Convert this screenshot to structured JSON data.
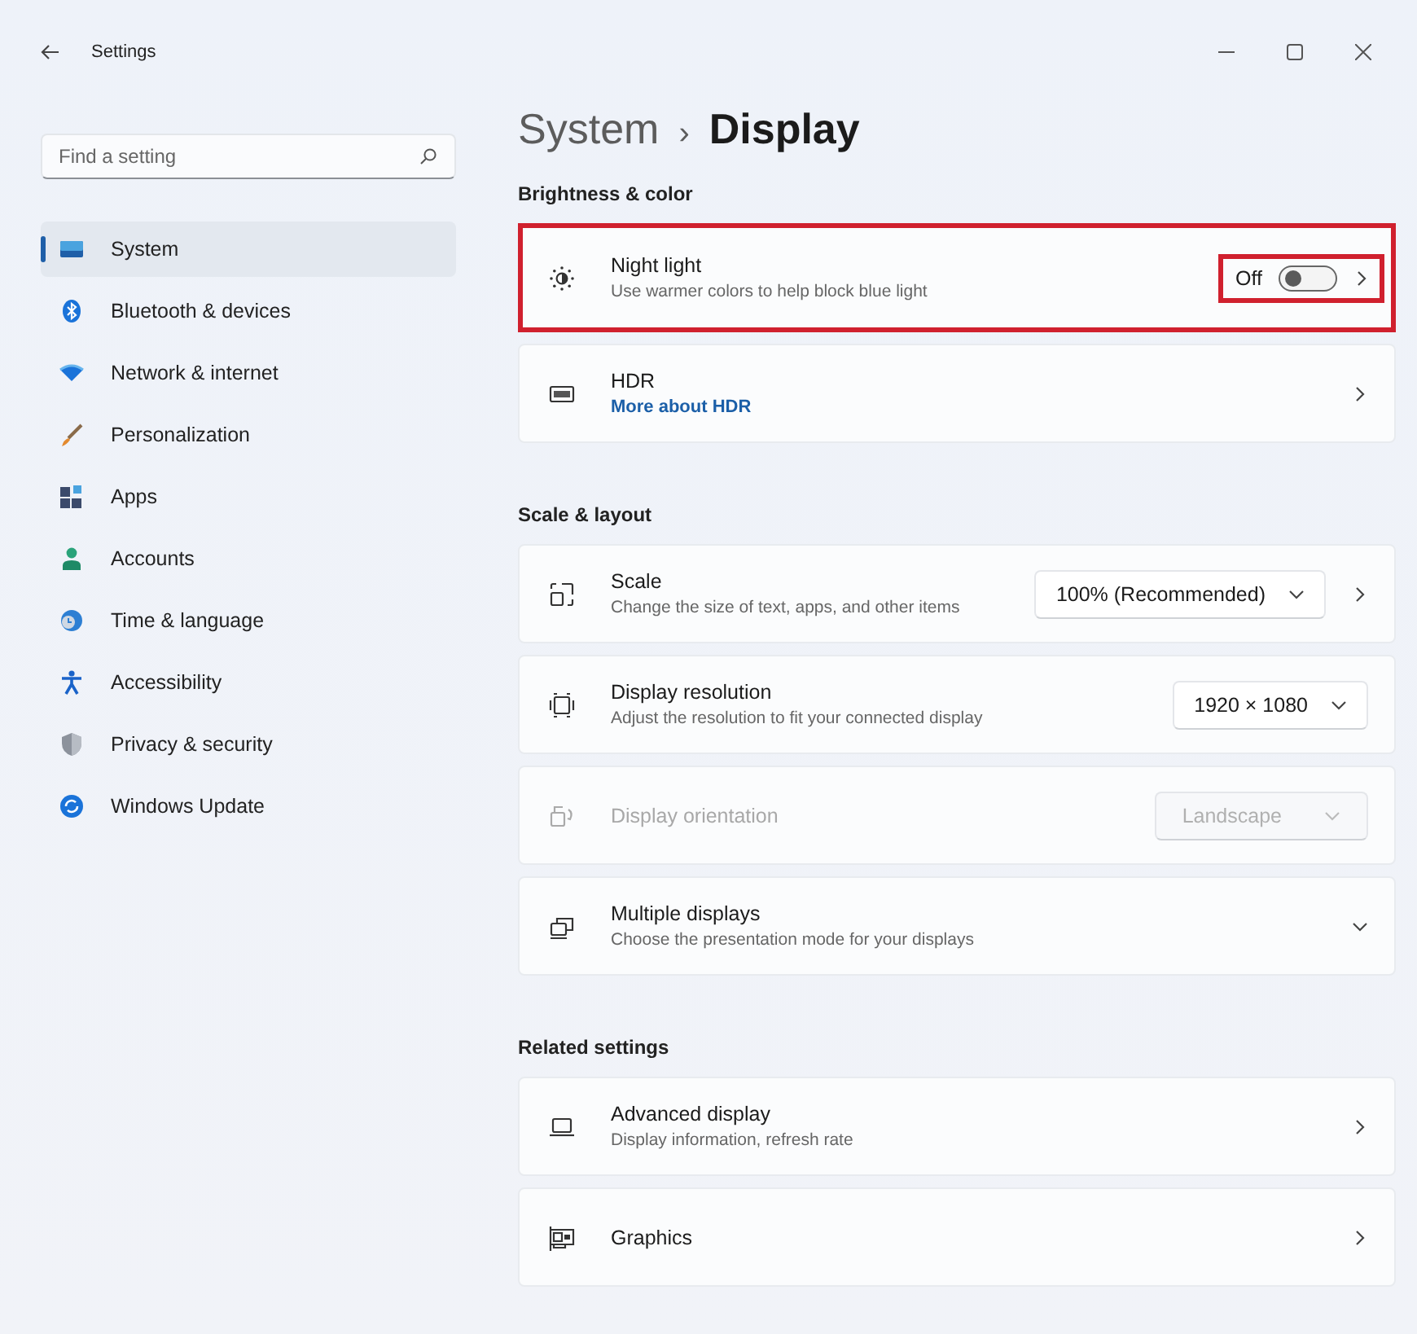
{
  "window": {
    "title": "Settings"
  },
  "search": {
    "placeholder": "Find a setting"
  },
  "sidebar": {
    "items": [
      {
        "label": "System",
        "selected": true
      },
      {
        "label": "Bluetooth & devices",
        "selected": false
      },
      {
        "label": "Network & internet",
        "selected": false
      },
      {
        "label": "Personalization",
        "selected": false
      },
      {
        "label": "Apps",
        "selected": false
      },
      {
        "label": "Accounts",
        "selected": false
      },
      {
        "label": "Time & language",
        "selected": false
      },
      {
        "label": "Accessibility",
        "selected": false
      },
      {
        "label": "Privacy & security",
        "selected": false
      },
      {
        "label": "Windows Update",
        "selected": false
      }
    ]
  },
  "breadcrumb": {
    "parent": "System",
    "separator": "›",
    "current": "Display"
  },
  "sections": [
    {
      "heading": "Brightness & color",
      "rows": [
        {
          "kind": "toggle",
          "title": "Night light",
          "subtitle": "Use warmer colors to help block blue light",
          "state_label": "Off",
          "on": false,
          "highlighted": true,
          "control_highlighted": true
        },
        {
          "kind": "nav",
          "title": "HDR",
          "link": "More about HDR",
          "highlighted": false,
          "control_highlighted": false
        }
      ]
    },
    {
      "heading": "Scale & layout",
      "rows": [
        {
          "kind": "dropdown",
          "title": "Scale",
          "subtitle": "Change the size of text, apps, and other items",
          "value": "100% (Recommended)",
          "disabled": false,
          "chevron": true
        },
        {
          "kind": "dropdown",
          "title": "Display resolution",
          "subtitle": "Adjust the resolution to fit your connected display",
          "value": "1920 × 1080",
          "disabled": false,
          "chevron": false
        },
        {
          "kind": "dropdown",
          "title": "Display orientation",
          "value": "Landscape",
          "disabled": true,
          "chevron": false
        },
        {
          "kind": "expander",
          "title": "Multiple displays",
          "subtitle": "Choose the presentation mode for your displays",
          "expanded": false
        }
      ]
    },
    {
      "heading": "Related settings",
      "rows": [
        {
          "kind": "nav",
          "title": "Advanced display",
          "subtitle": "Display information, refresh rate",
          "highlighted": false,
          "control_highlighted": false
        },
        {
          "kind": "nav",
          "title": "Graphics",
          "highlighted": false,
          "control_highlighted": false
        }
      ]
    }
  ]
}
